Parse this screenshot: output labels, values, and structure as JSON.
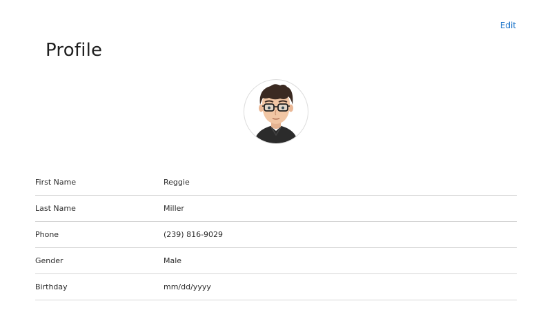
{
  "header": {
    "edit_label": "Edit",
    "title": "Profile"
  },
  "avatar": {
    "icon": "avatar-icon",
    "colors": {
      "hair": "#3b2a22",
      "skin": "#f1c6a4",
      "shirt": "#2b2b2b",
      "glasses": "#1e1e1e",
      "border": "#dcdcdc"
    }
  },
  "fields": [
    {
      "label": "First Name",
      "value": "Reggie"
    },
    {
      "label": "Last Name",
      "value": "Miller"
    },
    {
      "label": "Phone",
      "value": "(239) 816-9029"
    },
    {
      "label": "Gender",
      "value": "Male"
    },
    {
      "label": "Birthday",
      "value": "mm/dd/yyyy"
    }
  ],
  "colors": {
    "link": "#1a73c9",
    "divider": "#d4d4d4",
    "text": "#2a2a2a"
  }
}
